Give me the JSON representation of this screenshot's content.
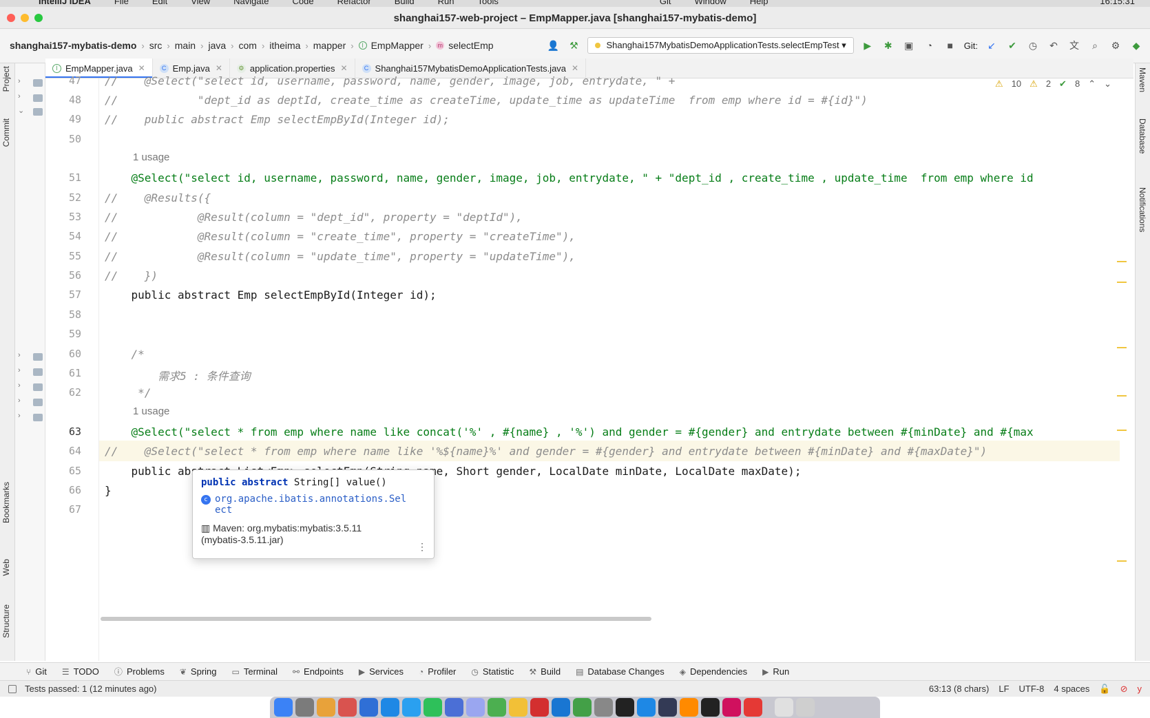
{
  "menubar": {
    "app": "IntelliJ IDEA",
    "items": [
      "File",
      "Edit",
      "View",
      "Navigate",
      "Code",
      "Refactor",
      "Build",
      "Run",
      "Tools",
      "Git",
      "Window",
      "Help"
    ],
    "clock": "16:15:31"
  },
  "window": {
    "title": "shanghai157-web-project – EmpMapper.java [shanghai157-mybatis-demo]"
  },
  "breadcrumbs": [
    "shanghai157-mybatis-demo",
    "src",
    "main",
    "java",
    "com",
    "itheima",
    "mapper",
    "EmpMapper",
    "selectEmp"
  ],
  "toolbar": {
    "run_config": "Shanghai157MybatisDemoApplicationTests.selectEmpTest",
    "git_label": "Git:"
  },
  "left_stripe": [
    "Project",
    "Commit",
    "Bookmarks",
    "Web",
    "Structure"
  ],
  "right_stripe": [
    "Maven",
    "Database",
    "Notifications"
  ],
  "tabs": [
    {
      "label": "EmpMapper.java",
      "icon": "interface-icon",
      "active": true
    },
    {
      "label": "Emp.java",
      "icon": "class-icon",
      "active": false
    },
    {
      "label": "application.properties",
      "icon": "properties-icon",
      "active": false
    },
    {
      "label": "Shanghai157MybatisDemoApplicationTests.java",
      "icon": "test-class-icon",
      "active": false
    }
  ],
  "inspections": {
    "warnings": "10",
    "weak_warnings": "2",
    "typos": "8"
  },
  "editor": {
    "lines": [
      {
        "n": "47",
        "text": "//    @Select(\"select id, username, password, name, gender, image, job, entrydate, \" +"
      },
      {
        "n": "48",
        "text": "//            \"dept_id as deptId, create_time as createTime, update_time as updateTime  from emp where id = #{id}\")"
      },
      {
        "n": "49",
        "text": "//    public abstract Emp selectEmpById(Integer id);"
      },
      {
        "n": "50",
        "text": ""
      },
      {
        "n": "51",
        "text": "    @Select(\"select id, username, password, name, gender, image, job, entrydate, \" + \"dept_id , create_time , update_time  from emp where id"
      },
      {
        "n": "52",
        "text": "//    @Results({"
      },
      {
        "n": "53",
        "text": "//            @Result(column = \"dept_id\", property = \"deptId\"),"
      },
      {
        "n": "54",
        "text": "//            @Result(column = \"create_time\", property = \"createTime\"),"
      },
      {
        "n": "55",
        "text": "//            @Result(column = \"update_time\", property = \"updateTime\"),"
      },
      {
        "n": "56",
        "text": "//    })"
      },
      {
        "n": "57",
        "text": "    public abstract Emp selectEmpById(Integer id);"
      },
      {
        "n": "58",
        "text": ""
      },
      {
        "n": "59",
        "text": ""
      },
      {
        "n": "60",
        "text": "    /*"
      },
      {
        "n": "61",
        "text": "        需求5 : 条件查询"
      },
      {
        "n": "62",
        "text": "     */"
      },
      {
        "n": "63",
        "text": "    @Select(\"select * from emp where name like concat('%' , #{name} , '%') and gender = #{gender} and entrydate between #{minDate} and #{max"
      },
      {
        "n": "64",
        "text": "//    @Select(\"select * from emp where name like '%${name}%' and gender = #{gender} and entrydate between #{minDate} and #{maxDate}\")"
      },
      {
        "n": "65",
        "text": "    public abstract List<Emp> selectEmp(String name, Short gender, LocalDate minDate, LocalDate maxDate);"
      },
      {
        "n": "66",
        "text": "}"
      },
      {
        "n": "67",
        "text": ""
      }
    ],
    "usage_label": "1 usage"
  },
  "popup": {
    "signature_kw": "public abstract",
    "signature_rest": " String[] value()",
    "link_line1": "org.apache.ibatis.annotations.Sel",
    "link_line2": "ect",
    "maven_line1": "Maven: org.mybatis:mybatis:3.5.11",
    "maven_line2": "(mybatis-3.5.11.jar)"
  },
  "bottom_tabs": [
    "Git",
    "TODO",
    "Problems",
    "Spring",
    "Terminal",
    "Endpoints",
    "Services",
    "Profiler",
    "Statistic",
    "Build",
    "Database Changes",
    "Dependencies",
    "Run"
  ],
  "status": {
    "message": "Tests passed: 1 (12 minutes ago)",
    "position": "63:13 (8 chars)",
    "line_sep": "LF",
    "encoding": "UTF-8",
    "indent": "4 spaces"
  },
  "colors": {
    "accent": "#3574f0",
    "annotation": "#9e880d",
    "string": "#067d17",
    "keyword": "#0033b3",
    "comment": "#8c8c8c"
  }
}
